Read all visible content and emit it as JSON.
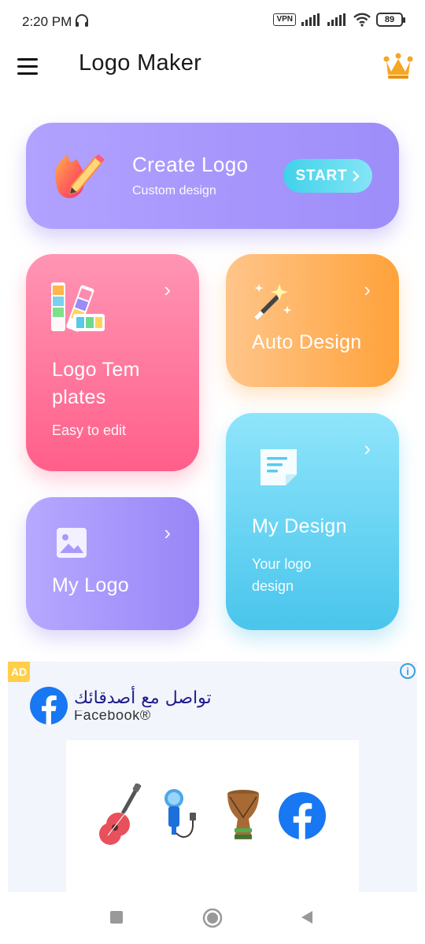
{
  "status_bar": {
    "time": "2:20 PM",
    "vpn": "VPN",
    "battery": "89"
  },
  "app_bar": {
    "title": "Logo Maker"
  },
  "cards": {
    "create_logo": {
      "title": "Create Logo",
      "subtitle": "Custom design",
      "button": "START"
    },
    "templates": {
      "title": "Logo Tem plates",
      "subtitle": "Easy to edit"
    },
    "auto_design": {
      "title": "Auto Design"
    },
    "my_logo": {
      "title": "My Logo"
    },
    "my_design": {
      "title": "My Design",
      "subtitle": "Your logo design"
    }
  },
  "ad": {
    "badge": "AD",
    "headline": "تواصل مع أصدقائك",
    "brand": "Facebook®",
    "icons": [
      "guitar-icon",
      "microphone-icon",
      "drum-icon",
      "facebook-icon"
    ]
  },
  "colors": {
    "create_card": "#9d8df9",
    "templates_card": "#ff5f8a",
    "auto_card": "#ffa23a",
    "my_logo_card": "#9886f7",
    "my_design_card": "#49c5ec",
    "start_button": "#40d2ea",
    "facebook_blue": "#1877f2",
    "crown": "#f5a623"
  }
}
